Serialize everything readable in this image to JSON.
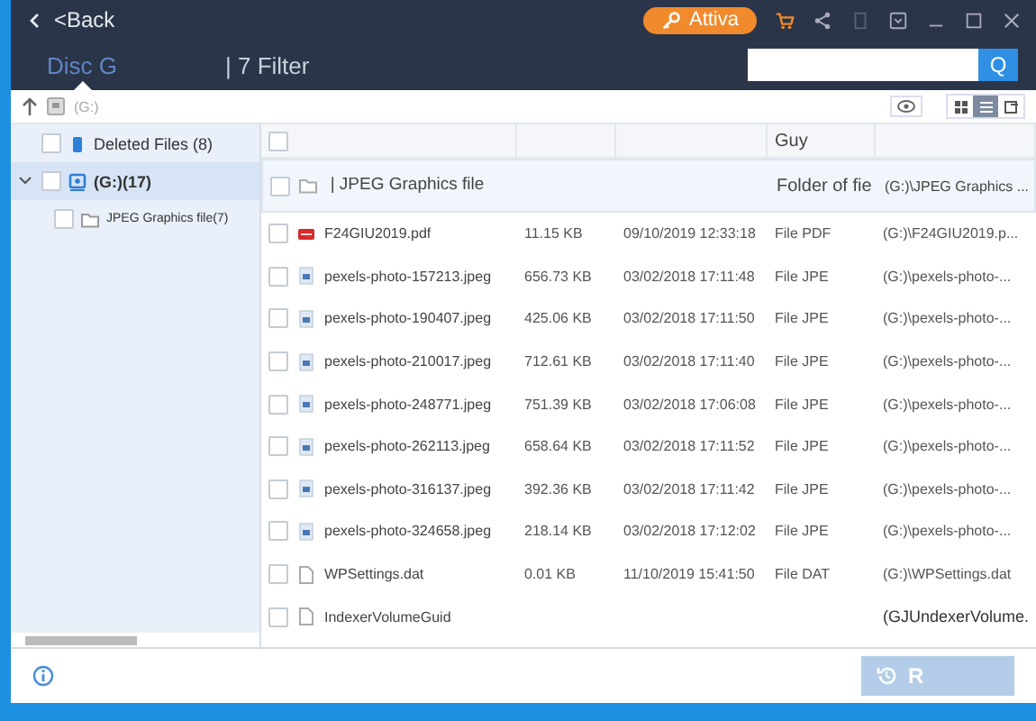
{
  "header": {
    "back": "<Back",
    "activate_button": "Attiva",
    "tabs": [
      {
        "label": "Disc G",
        "selected": true
      },
      {
        "label": "| 7 Filter",
        "selected": false
      }
    ],
    "search": {
      "button": "Q"
    }
  },
  "toolbar": {
    "path": "(G:)",
    "views": [
      {
        "selected": false
      },
      {
        "selected": true
      },
      {
        "selected": false
      }
    ]
  },
  "tree": [
    {
      "label": "Deleted Files (8)",
      "checked": false,
      "selected": false
    },
    {
      "label": "(G:)(17)",
      "checked": false,
      "selected": true,
      "expanded": true,
      "children": [
        {
          "label": "JPEG Graphics file(7)",
          "checked": false,
          "selected": false
        }
      ]
    }
  ],
  "table": {
    "all_checked": false,
    "columns": [
      "",
      "",
      "",
      "Guy",
      ""
    ],
    "rows": [
      {
        "kind": "folder",
        "checked": false,
        "name": "| JPEG Graphics file",
        "size": "",
        "date": "",
        "type": "Folder of fie",
        "path": "(G:)\\JPEG Graphics ..."
      },
      {
        "kind": "pdf",
        "checked": false,
        "name": "F24GIU2019.pdf",
        "size": "11.15 KB",
        "date": "09/10/2019 12:33:18",
        "type": "File PDF",
        "path": "(G:)\\F24GIU2019.p..."
      },
      {
        "kind": "image",
        "checked": false,
        "name": "pexels-photo-157213.jpeg",
        "size": "656.73 KB",
        "date": "03/02/2018 17:11:48",
        "type": "File JPE",
        "path": "(G:)\\pexels-photo-..."
      },
      {
        "kind": "image",
        "checked": false,
        "name": "pexels-photo-190407.jpeg",
        "size": "425.06 KB",
        "date": "03/02/2018 17:11:50",
        "type": "File JPE",
        "path": "(G:)\\pexels-photo-..."
      },
      {
        "kind": "image",
        "checked": false,
        "name": "pexels-photo-210017.jpeg",
        "size": "712.61 KB",
        "date": "03/02/2018 17:11:40",
        "type": "File JPE",
        "path": "(G:)\\pexels-photo-..."
      },
      {
        "kind": "image",
        "checked": false,
        "name": "pexels-photo-248771.jpeg",
        "size": "751.39 KB",
        "date": "03/02/2018 17:06:08",
        "type": "File JPE",
        "path": "(G:)\\pexels-photo-..."
      },
      {
        "kind": "image",
        "checked": false,
        "name": "pexels-photo-262113.jpeg",
        "size": "658.64 KB",
        "date": "03/02/2018 17:11:52",
        "type": "File JPE",
        "path": "(G:)\\pexels-photo-..."
      },
      {
        "kind": "image",
        "checked": false,
        "name": "pexels-photo-316137.jpeg",
        "size": "392.36 KB",
        "date": "03/02/2018 17:11:42",
        "type": "File JPE",
        "path": "(G:)\\pexels-photo-..."
      },
      {
        "kind": "image",
        "checked": false,
        "name": "pexels-photo-324658.jpeg",
        "size": "218.14 KB",
        "date": "03/02/2018 17:12:02",
        "type": "File JPE",
        "path": "(G:)\\pexels-photo-..."
      },
      {
        "kind": "file",
        "checked": false,
        "name": "WPSettings.dat",
        "size": "0.01 KB",
        "date": "11/10/2019 15:41:50",
        "type": "File DAT",
        "path": "(G:)\\WPSettings.dat"
      },
      {
        "kind": "file",
        "checked": false,
        "name": "IndexerVolumeGuid",
        "size": "",
        "date": "",
        "type": "",
        "path": "(GJUndexerVolume."
      }
    ]
  },
  "footer": {
    "restore_button": "R"
  }
}
